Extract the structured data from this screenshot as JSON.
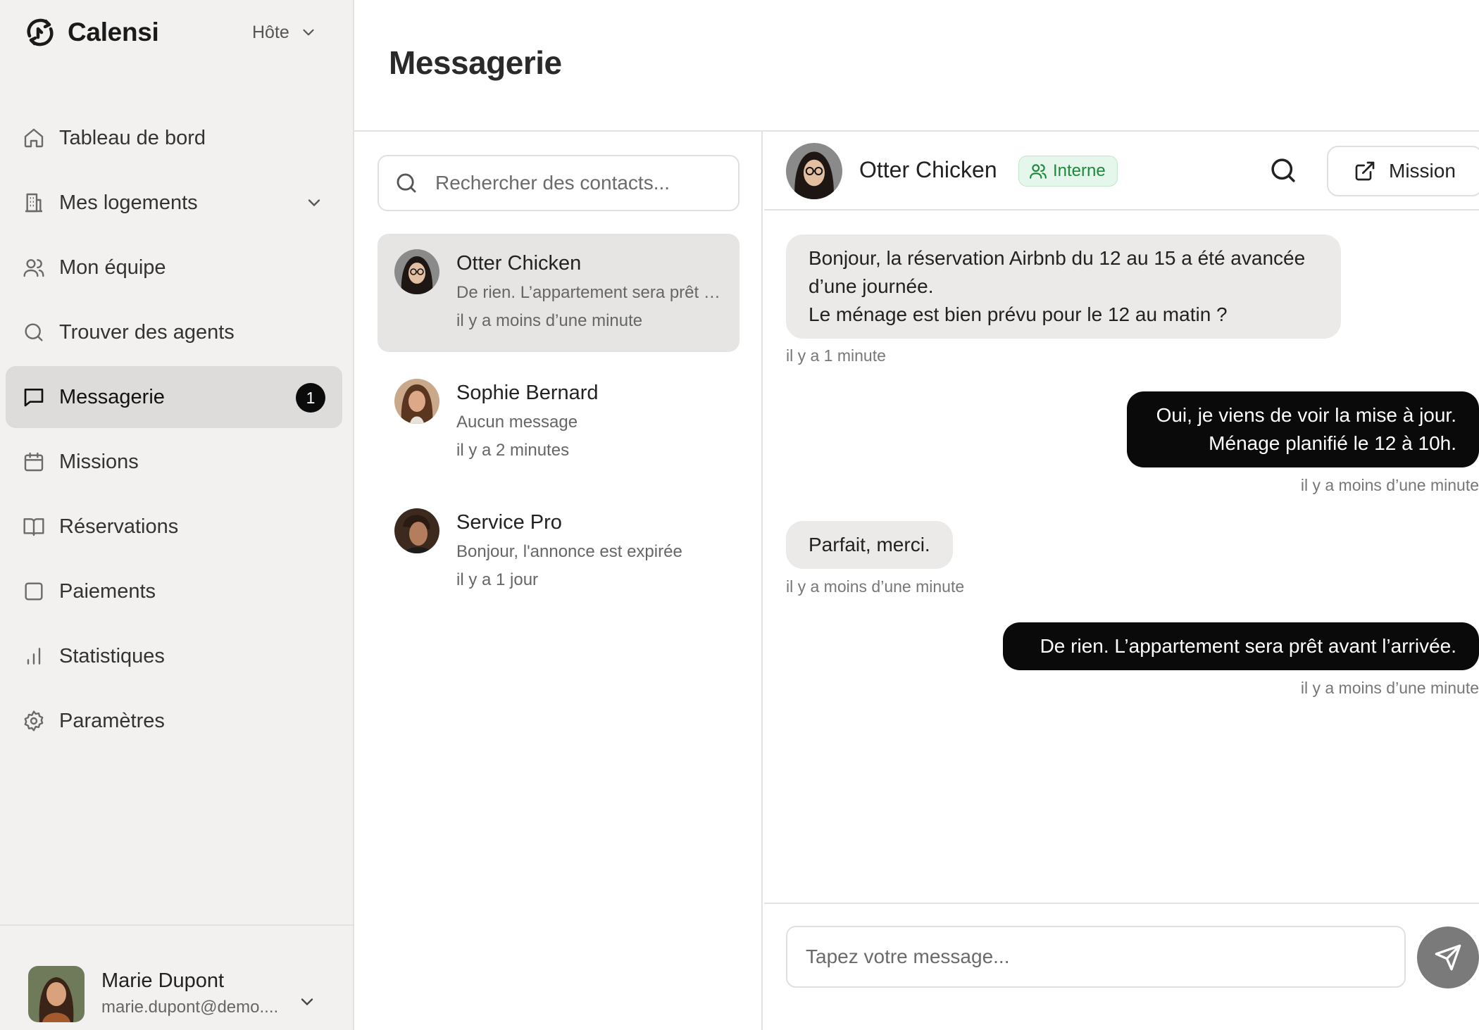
{
  "app": {
    "brand": "Calensi",
    "role": "Hôte"
  },
  "sidebar": {
    "items": [
      {
        "label": "Tableau de bord",
        "icon": "home-icon"
      },
      {
        "label": "Mes logements",
        "icon": "building-icon"
      },
      {
        "label": "Mon équipe",
        "icon": "users-icon"
      },
      {
        "label": "Trouver des agents",
        "icon": "search-icon"
      },
      {
        "label": "Messagerie",
        "icon": "message-square-icon",
        "badge": "1"
      },
      {
        "label": "Missions",
        "icon": "calendar-icon"
      },
      {
        "label": "Réservations",
        "icon": "book-open-icon"
      },
      {
        "label": "Paiements",
        "icon": "square-icon"
      },
      {
        "label": "Statistiques",
        "icon": "bar-chart-icon"
      },
      {
        "label": "Paramètres",
        "icon": "settings-icon"
      }
    ],
    "active_index": 4
  },
  "user": {
    "name": "Marie Dupont",
    "email": "marie.dupont@demo...."
  },
  "page": {
    "title": "Messagerie"
  },
  "contacts": {
    "search_placeholder": "Rechercher des contacts...",
    "items": [
      {
        "name": "Otter Chicken",
        "preview": "De rien. L’appartement sera prêt avant l’arrivée.",
        "time": "il y a moins d’une minute"
      },
      {
        "name": "Sophie Bernard",
        "preview": "Aucun message",
        "time": "il y a 2 minutes"
      },
      {
        "name": "Service Pro",
        "preview": "Bonjour, l'annonce est expirée",
        "time": "il y a 1 jour"
      }
    ]
  },
  "chat": {
    "contact_name": "Otter Chicken",
    "tag": "Interne",
    "mission_button": "Mission",
    "messages": [
      {
        "direction": "in",
        "lines": [
          "Bonjour, la réservation Airbnb du 12 au 15 a été avancée",
          "d’une journée.",
          "Le ménage est bien prévu pour le 12 au matin ?"
        ],
        "time": "il y a 1 minute"
      },
      {
        "direction": "out",
        "lines": [
          "Oui, je viens de voir la mise à jour.",
          "Ménage planifié le 12 à 10h."
        ],
        "time": "il y a moins d’une minute"
      },
      {
        "direction": "in",
        "lines": [
          "Parfait, merci."
        ],
        "time": "il y a moins d’une minute"
      },
      {
        "direction": "out",
        "lines": [
          "De rien. L’appartement sera prêt avant l’arrivée."
        ],
        "time": "il y a moins d’une minute"
      }
    ],
    "composer_placeholder": "Tapez votre message..."
  },
  "colors": {
    "accent": "#0a0a0a",
    "tag_bg": "#e4f7ea",
    "tag_text": "#1c8a3d",
    "sidebar_bg": "#f2f1f0",
    "send_button": "#7a7a7a"
  }
}
